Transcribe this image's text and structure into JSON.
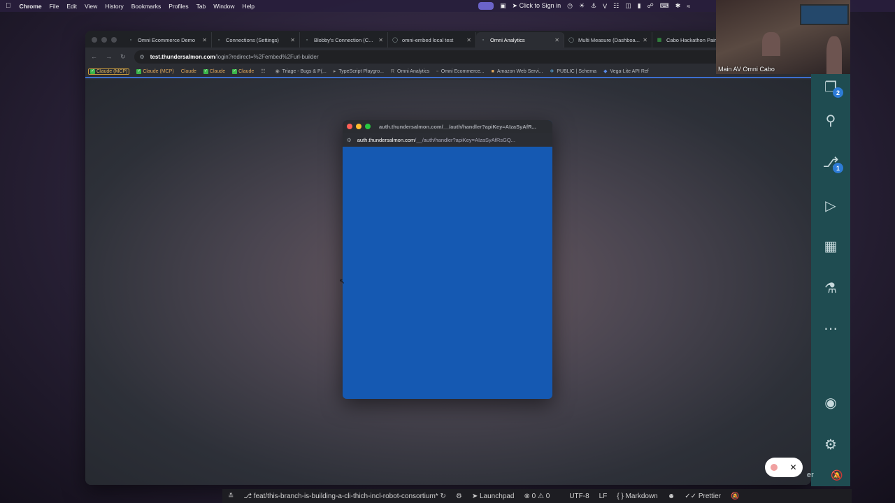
{
  "menubar": {
    "items": [
      "Chrome",
      "File",
      "Edit",
      "View",
      "History",
      "Bookmarks",
      "Profiles",
      "Tab",
      "Window",
      "Help"
    ],
    "sign_in": "Click to Sign in"
  },
  "tabs": [
    {
      "title": "Omni Ecommerce Demo",
      "active": false
    },
    {
      "title": "Connections (Settings)",
      "active": false
    },
    {
      "title": "Blobby's Connection (C...",
      "active": false
    },
    {
      "title": "omni-embed local test",
      "active": false
    },
    {
      "title": "Omni Analytics",
      "active": true
    },
    {
      "title": "Multi Measure (Dashboa...",
      "active": false
    },
    {
      "title": "Cabo Hackathon Pairing",
      "active": false
    }
  ],
  "address": {
    "host": "test.thundersalmon.com",
    "path": "/login?redirect=%2Fembed%2Furl-builder"
  },
  "bookmarks": [
    {
      "label": "Claude (MCP)",
      "style": "boxed",
      "check": true
    },
    {
      "label": "Claude (MCP)",
      "style": "orange",
      "check": true
    },
    {
      "label": "Claude",
      "style": "orange",
      "check": false
    },
    {
      "label": "Claude",
      "style": "orange",
      "check": true
    },
    {
      "label": "Claude",
      "style": "orange",
      "check": true
    },
    {
      "label": "Triage - Bugs & P(...",
      "style": "plain",
      "check": false
    },
    {
      "label": "TypeScript Playgro...",
      "style": "plain",
      "check": false
    },
    {
      "label": "Omni Analytics",
      "style": "plain",
      "check": false
    },
    {
      "label": "Omni Ecommerce...",
      "style": "plain",
      "check": false
    },
    {
      "label": "Amazon Web Servi...",
      "style": "plain",
      "check": false
    },
    {
      "label": "PUBLIC | Schema",
      "style": "plain",
      "check": false
    },
    {
      "label": "Vega-Lite API Ref",
      "style": "plain",
      "check": false
    }
  ],
  "popup": {
    "title": "auth.thundersalmon.com/__/auth/handler?apiKey=AIzaSyAfR...",
    "url_host": "auth.thundersalmon.com",
    "url_path": "/__/auth/handler?apiKey=AIzaSyAfRsGQ...",
    "background": "#1559b2"
  },
  "vscode": {
    "badges": {
      "explorer": "2",
      "source_control": "1"
    },
    "status": {
      "branch": "feat/this-branch-is-building-a-cli-thich-incl-robot-consortium*",
      "launchpad": "Launchpad",
      "errors": "0",
      "warnings": "0",
      "encoding": "UTF-8",
      "eol": "LF",
      "language": "Markdown",
      "formatter": "Prettier"
    }
  },
  "webcam": {
    "caption": "Main AV Omni Cabo"
  },
  "colors": {
    "accent": "#3d6fd1",
    "sidebar": "#1f4c51",
    "popup": "#1559b2"
  }
}
